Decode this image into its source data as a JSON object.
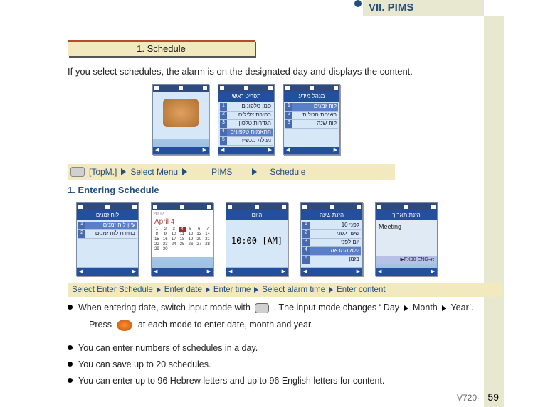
{
  "chapter": "VII.  PIMS",
  "section_header": "1. Schedule",
  "intro": "If you select schedules, the alarm is on the designated day and displays the content.",
  "breadcrumb": {
    "topm": "[TopM.]",
    "select_menu": "Select Menu",
    "pims": "PIMS",
    "schedule": "Schedule"
  },
  "subsection": "1. Entering Schedule",
  "phone_row1": {
    "titles": [
      "",
      "תפריט ראשי",
      "תפריט ראשי",
      "מנהל מידע"
    ],
    "p2_items": [
      "סמן טלפונים",
      "בחירת צלילים",
      "הגדרות טלפון",
      "התאמות טלפונים",
      "נעילת מכשיר"
    ],
    "p3_items": [
      "לוח זמנים",
      "רשימת מטלות",
      "לוח שנה"
    ]
  },
  "phone_row2": {
    "titles": [
      "לוח זמנים",
      "",
      "היום",
      "הזנת שעה",
      "הזנת תאריך"
    ],
    "p0_items": [
      "עיון לוח זמנים",
      "בחירת לוח זמנים"
    ],
    "cal_month": "April 4",
    "cal_year": "2002",
    "cal_days": [
      "1",
      "2",
      "3",
      "4",
      "5",
      "6",
      "7",
      "8",
      "9",
      "10",
      "11",
      "12",
      "13",
      "14",
      "15",
      "16",
      "17",
      "18",
      "19",
      "20",
      "21",
      "22",
      "23",
      "24",
      "25",
      "26",
      "27",
      "28",
      "29",
      "30"
    ],
    "time": "10:00 [AM]",
    "p3_items": [
      "10 לפני",
      "שעה לפני",
      "יום לפני",
      "ללא התראה",
      "בזמן"
    ],
    "meeting": "Meeting",
    "fx_label": "▶FX00 ENG–א"
  },
  "steps": {
    "s1": "Select Enter Schedule",
    "s2": "Enter date",
    "s3": "Enter time",
    "s4": "Select alarm time",
    "s5": "Enter content"
  },
  "bullets": {
    "b1a": "When entering date, switch input mode with",
    "b1b": ". The input mode changes ‘  Day",
    "b1c": "Month",
    "b1d": "Year’.",
    "b1_press_a": "Press",
    "b1_press_b": "at each mode to enter date, month and year.",
    "b2": "You can enter numbers of schedules in a day.",
    "b3": "You can save up to 20 schedules.",
    "b4": "You can enter up to 96 Hebrew letters and up to 96 English letters for content."
  },
  "footer_model": "V720·",
  "footer_page": "59"
}
